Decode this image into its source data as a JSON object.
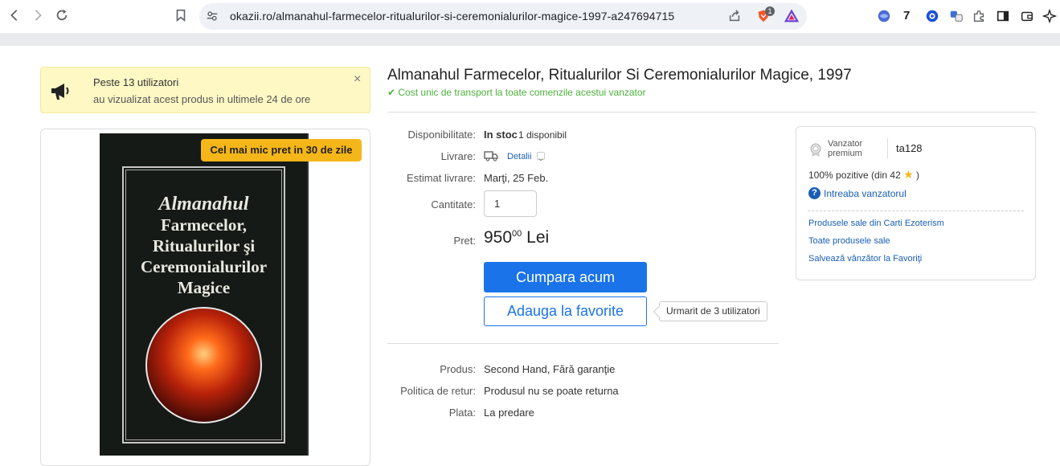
{
  "browser": {
    "url": "okazii.ro/almanahul-farmecelor-ritualurilor-si-ceremonialurilor-magice-1997-a247694715",
    "extension_count": "7",
    "brave_badge": "1",
    "icons": [
      "back-icon",
      "forward-icon",
      "reload-icon",
      "bookmark-icon",
      "site-settings-icon",
      "share-icon",
      "brave-shield-icon",
      "brave-rewards-icon",
      "vpn-icon",
      "counter-extension-icon",
      "extension-icon",
      "translate-icon",
      "puzzle-icon",
      "sidebar-icon",
      "wallet-icon",
      "ai-icon"
    ]
  },
  "notice": {
    "title": "Peste 13 utilizatori",
    "subtitle": "au vizualizat acest produs in ultimele 24 de ore",
    "close": "×"
  },
  "image": {
    "badge": "Cel mai mic pret in 30 de zile",
    "book_title_lines": [
      "Almanahul",
      "Farmecelor,",
      "Ritualurilor şi",
      "Ceremonialurilor",
      "Magice"
    ]
  },
  "product": {
    "title": "Almanahul Farmecelor, Ritualurilor Si Ceremonialurilor Magice, 1997",
    "shipping": "✔ Cost unic de transport la toate comenzile acestui vanzator"
  },
  "details": {
    "availability_label": "Disponibilitate:",
    "availability_value": "In stoc",
    "availability_count": "1 disponibil",
    "delivery_label": "Livrare:",
    "delivery_link": "Detalii",
    "estimate_label": "Estimat livrare:",
    "estimate_value": "Marţi, 25 Feb.",
    "quantity_label": "Cantitate:",
    "quantity_value": "1",
    "price_label": "Pret:",
    "price_main": "950",
    "price_cents": "00",
    "price_currency": "Lei",
    "buy_button": "Cumpara acum",
    "fav_button": "Adauga la favorite",
    "followers": "Urmarit de 3 utilizatori"
  },
  "extra": {
    "product_label": "Produs:",
    "product_value": "Second Hand, Fără garanţie",
    "return_label": "Politica de retur:",
    "return_value": "Produsul nu se poate returna",
    "payment_label": "Plata:",
    "payment_value": "La predare"
  },
  "seller": {
    "type_line1": "Vanzator",
    "type_line2": "premium",
    "name": "ta128",
    "rating": "100% pozitive (din 42",
    "rating_end": ")",
    "ask": "Intreaba vanzatorul",
    "link1": "Produsele sale din Carti Ezoterism",
    "link2": "Toate produsele sale",
    "link3": "Salvează vânzător la Favoriţi"
  },
  "colors": {
    "accent": "#1a73e8",
    "badge": "#f5b61a",
    "notice_bg": "#fdf8c4",
    "shipping_green": "#4caf3c"
  }
}
